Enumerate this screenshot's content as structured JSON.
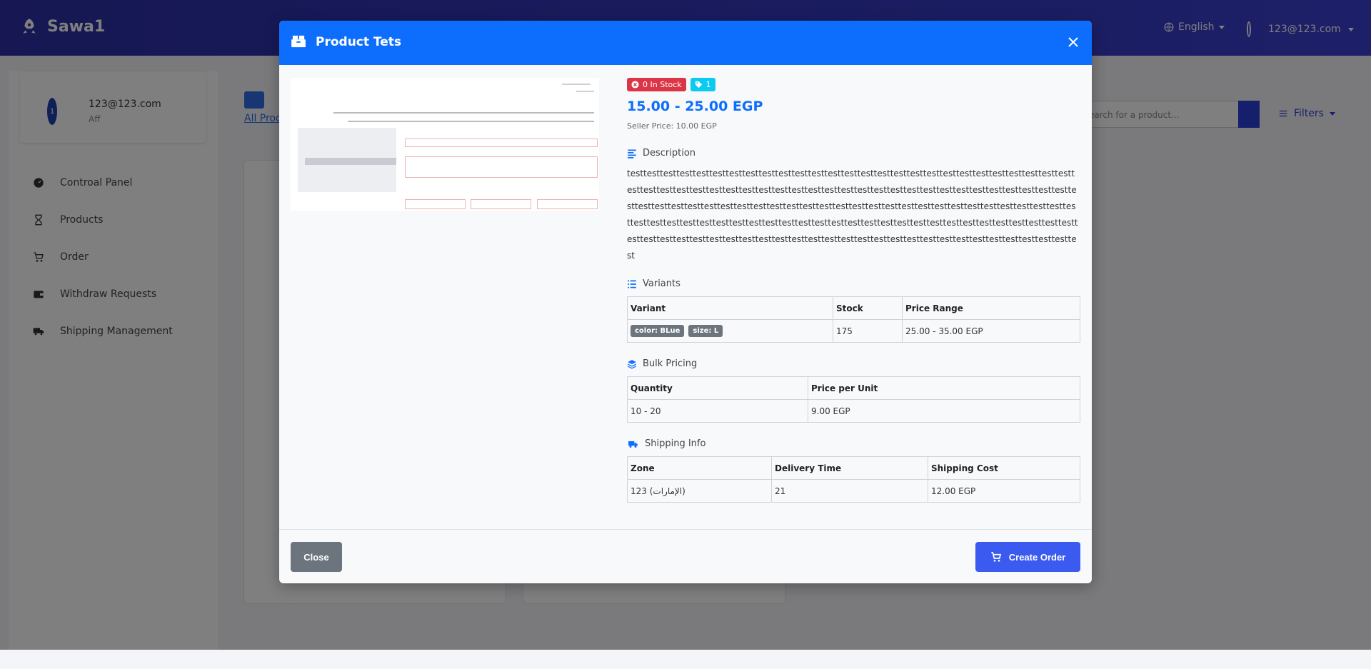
{
  "app": {
    "brand": "Sawa1",
    "language": "English",
    "user_email": "123@123.com"
  },
  "sidebar": {
    "user": {
      "avatar_initial": "1",
      "email": "123@123.com",
      "role": "Aff"
    },
    "items": [
      {
        "label": "Controal Panel",
        "icon": "dashboard-icon"
      },
      {
        "label": "Products",
        "icon": "hourglass-icon"
      },
      {
        "label": "Order",
        "icon": "cart-icon"
      },
      {
        "label": "Withdraw Requests",
        "icon": "wallet-icon"
      },
      {
        "label": "Shipping Management",
        "icon": "truck-icon"
      }
    ]
  },
  "main": {
    "tab_label": "All Produ",
    "search_placeholder": "earch for a product...",
    "filters_label": "Filters"
  },
  "modal": {
    "title": "Product Tets",
    "stock_badge": "0 In Stock",
    "tag_badge": "1",
    "price_range": "15.00 - 25.00 EGP",
    "seller_price": "Seller Price: 10.00 EGP",
    "description_title": "Description",
    "description": "testtesttesttesttesttesttesttesttesttesttesttesttesttesttesttesttesttesttesttesttesttesttesttesttesttesttesttesttesttesttesttesttesttesttesttesttesttesttesttesttesttesttesttesttesttesttesttesttesttesttesttesttesttesttesttesttesttesttesttesttesttesttesttesttesttesttesttesttesttesttesttesttesttesttesttesttesttesttesttesttesttesttesttesttesttesttesttesttesttesttesttesttesttesttesttesttesttesttesttesttesttesttesttesttesttesttesttesttesttesttesttesttesttesttesttesttesttesttesttesttesttesttesttesttesttesttesttesttesttesttesttesttesttesttesttesttest",
    "variants_title": "Variants",
    "variants_headers": [
      "Variant",
      "Stock",
      "Price Range"
    ],
    "variants_rows": [
      {
        "chips": [
          "color: BLue",
          "size: L"
        ],
        "stock": "175",
        "price_range": "25.00 - 35.00 EGP"
      }
    ],
    "bulk_title": "Bulk Pricing",
    "bulk_headers": [
      "Quantity",
      "Price per Unit"
    ],
    "bulk_rows": [
      {
        "quantity": "10 - 20",
        "price": "9.00 EGP"
      }
    ],
    "shipping_title": "Shipping Info",
    "shipping_headers": [
      "Zone",
      "Delivery Time",
      "Shipping Cost"
    ],
    "shipping_rows": [
      {
        "zone": "123 (الإمارات)",
        "delivery": "21",
        "cost": "12.00 EGP"
      }
    ],
    "close_button": "Close",
    "create_button": "Create Order"
  },
  "colors": {
    "header": "#0d6efd",
    "price": "#0d6efd",
    "stock_badge": "#dc3545",
    "tag_badge": "#0dcaf0",
    "create_button": "#3b5bf0",
    "close_button": "#6c757d",
    "topbar": "#3b3fd1"
  }
}
